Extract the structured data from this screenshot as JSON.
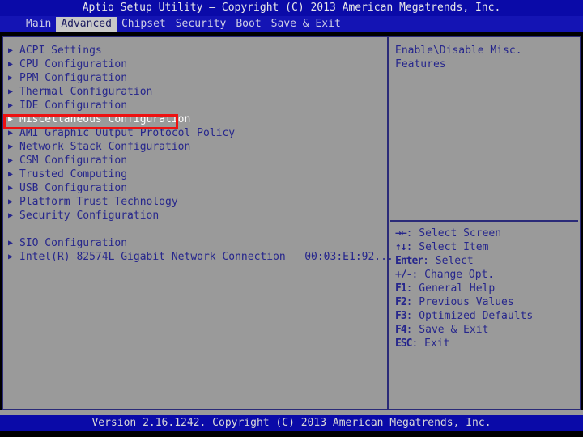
{
  "window": {
    "title": "Aptio Setup Utility – Copyright (C) 2013 American Megatrends, Inc.",
    "footer": "Version 2.16.1242. Copyright (C) 2013 American Megatrends, Inc."
  },
  "colors": {
    "title_bar_bg": "#0a0aa8",
    "menu_bar_bg": "#1414b4",
    "panel_bg": "#9a9a9a",
    "frame_border": "#2a2a78",
    "text": "#26268c",
    "selected_text": "#ffffff",
    "active_tab_bg": "#c8c8c8",
    "active_tab_text": "#1a1a5e",
    "annotation_red": "#ee1111"
  },
  "menubar": {
    "tabs": [
      {
        "label": "Main",
        "active": false
      },
      {
        "label": "Advanced",
        "active": true
      },
      {
        "label": "Chipset",
        "active": false
      },
      {
        "label": "Security",
        "active": false
      },
      {
        "label": "Boot",
        "active": false
      },
      {
        "label": "Save & Exit",
        "active": false
      }
    ]
  },
  "main": {
    "items": [
      {
        "label": "ACPI Settings",
        "selected": false,
        "spacer": false
      },
      {
        "label": "CPU Configuration",
        "selected": false,
        "spacer": false
      },
      {
        "label": "PPM Configuration",
        "selected": false,
        "spacer": false
      },
      {
        "label": "Thermal Configuration",
        "selected": false,
        "spacer": false
      },
      {
        "label": "IDE Configuration",
        "selected": false,
        "spacer": false
      },
      {
        "label": "Miscellaneous Configuration",
        "selected": true,
        "spacer": false
      },
      {
        "label": "AMI Graphic Output Protocol Policy",
        "selected": false,
        "spacer": false
      },
      {
        "label": "Network Stack Configuration",
        "selected": false,
        "spacer": false
      },
      {
        "label": "CSM Configuration",
        "selected": false,
        "spacer": false
      },
      {
        "label": "Trusted Computing",
        "selected": false,
        "spacer": false
      },
      {
        "label": "USB Configuration",
        "selected": false,
        "spacer": false
      },
      {
        "label": "Platform Trust Technology",
        "selected": false,
        "spacer": false
      },
      {
        "label": "Security Configuration",
        "selected": false,
        "spacer": false
      },
      {
        "label": "",
        "selected": false,
        "spacer": true
      },
      {
        "label": "SIO Configuration",
        "selected": false,
        "spacer": false
      },
      {
        "label": "Intel(R) 82574L Gigabit Network Connection – 00:03:E1:92...",
        "selected": false,
        "spacer": false
      }
    ],
    "bullet_glyph": "▶"
  },
  "help": {
    "text": "Enable\\Disable Misc. Features"
  },
  "legend": {
    "rows": [
      {
        "keys": "→←",
        "desc": ": Select Screen"
      },
      {
        "keys": "↑↓",
        "desc": ": Select Item"
      },
      {
        "keys": "Enter",
        "desc": ": Select"
      },
      {
        "keys": "+/-",
        "desc": ": Change Opt."
      },
      {
        "keys": "F1",
        "desc": ": General Help"
      },
      {
        "keys": "F2",
        "desc": ": Previous Values"
      },
      {
        "keys": "F3",
        "desc": ": Optimized Defaults"
      },
      {
        "keys": "F4",
        "desc": ": Save & Exit"
      },
      {
        "keys": "ESC",
        "desc": ": Exit"
      }
    ]
  },
  "annotation": {
    "target_label": "Miscellaneous Configuration"
  }
}
